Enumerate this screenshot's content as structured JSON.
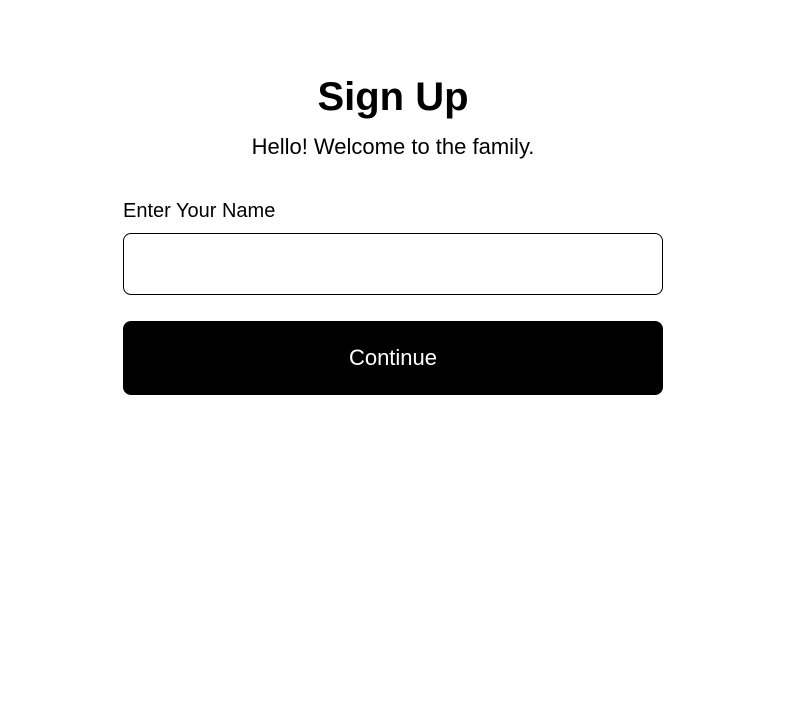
{
  "heading": "Sign Up",
  "subheading": "Hello! Welcome to the family.",
  "form": {
    "name_label": "Enter Your Name",
    "name_value": "",
    "continue_label": "Continue"
  }
}
